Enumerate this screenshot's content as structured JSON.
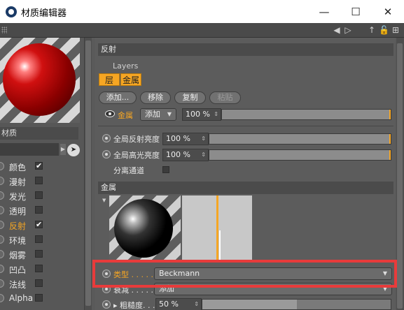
{
  "window": {
    "title": "材质编辑器",
    "minimize": "—",
    "maximize": "☐",
    "close": "✕"
  },
  "toolbar": {
    "nav_icons": [
      "◀",
      "▷",
      "↑",
      "🔓",
      "⊞"
    ]
  },
  "left": {
    "material_label": "材质",
    "channels": [
      {
        "label": "颜色",
        "checked": true,
        "active": false
      },
      {
        "label": "漫射",
        "checked": false,
        "active": false
      },
      {
        "label": "发光",
        "checked": false,
        "active": false
      },
      {
        "label": "透明",
        "checked": false,
        "active": false
      },
      {
        "label": "反射",
        "checked": true,
        "active": true
      },
      {
        "label": "环境",
        "checked": false,
        "active": false
      },
      {
        "label": "烟雾",
        "checked": false,
        "active": false
      },
      {
        "label": "凹凸",
        "checked": false,
        "active": false
      },
      {
        "label": "法线",
        "checked": false,
        "active": false
      },
      {
        "label": "Alpha",
        "checked": false,
        "active": false
      }
    ]
  },
  "reflection": {
    "header": "反射",
    "layers_label": "Layers",
    "tab_layer": "层",
    "tab_metal": "金属",
    "btn_add": "添加...",
    "btn_remove": "移除",
    "btn_copy": "复制",
    "btn_paste": "粘贴",
    "layer_name": "金属",
    "blend_mode": "添加",
    "layer_percent": "100 %",
    "global_reflect_label": "全局反射亮度",
    "global_reflect_value": "100 %",
    "global_spec_label": "全局高光亮度",
    "global_spec_value": "100 %",
    "separate_label": "分离通道"
  },
  "metal": {
    "header": "金属",
    "type_label": "类型",
    "type_dots": " . . . . .",
    "type_value": "Beckmann",
    "falloff_label": "衰减",
    "falloff_dots": " . . . . .",
    "falloff_value": "添加",
    "roughness_label": "粗糙度",
    "roughness_dots": ". . .",
    "roughness_value": "50 %"
  },
  "colors": {
    "accent": "#f6a623",
    "highlight_box": "#e83b3b"
  }
}
